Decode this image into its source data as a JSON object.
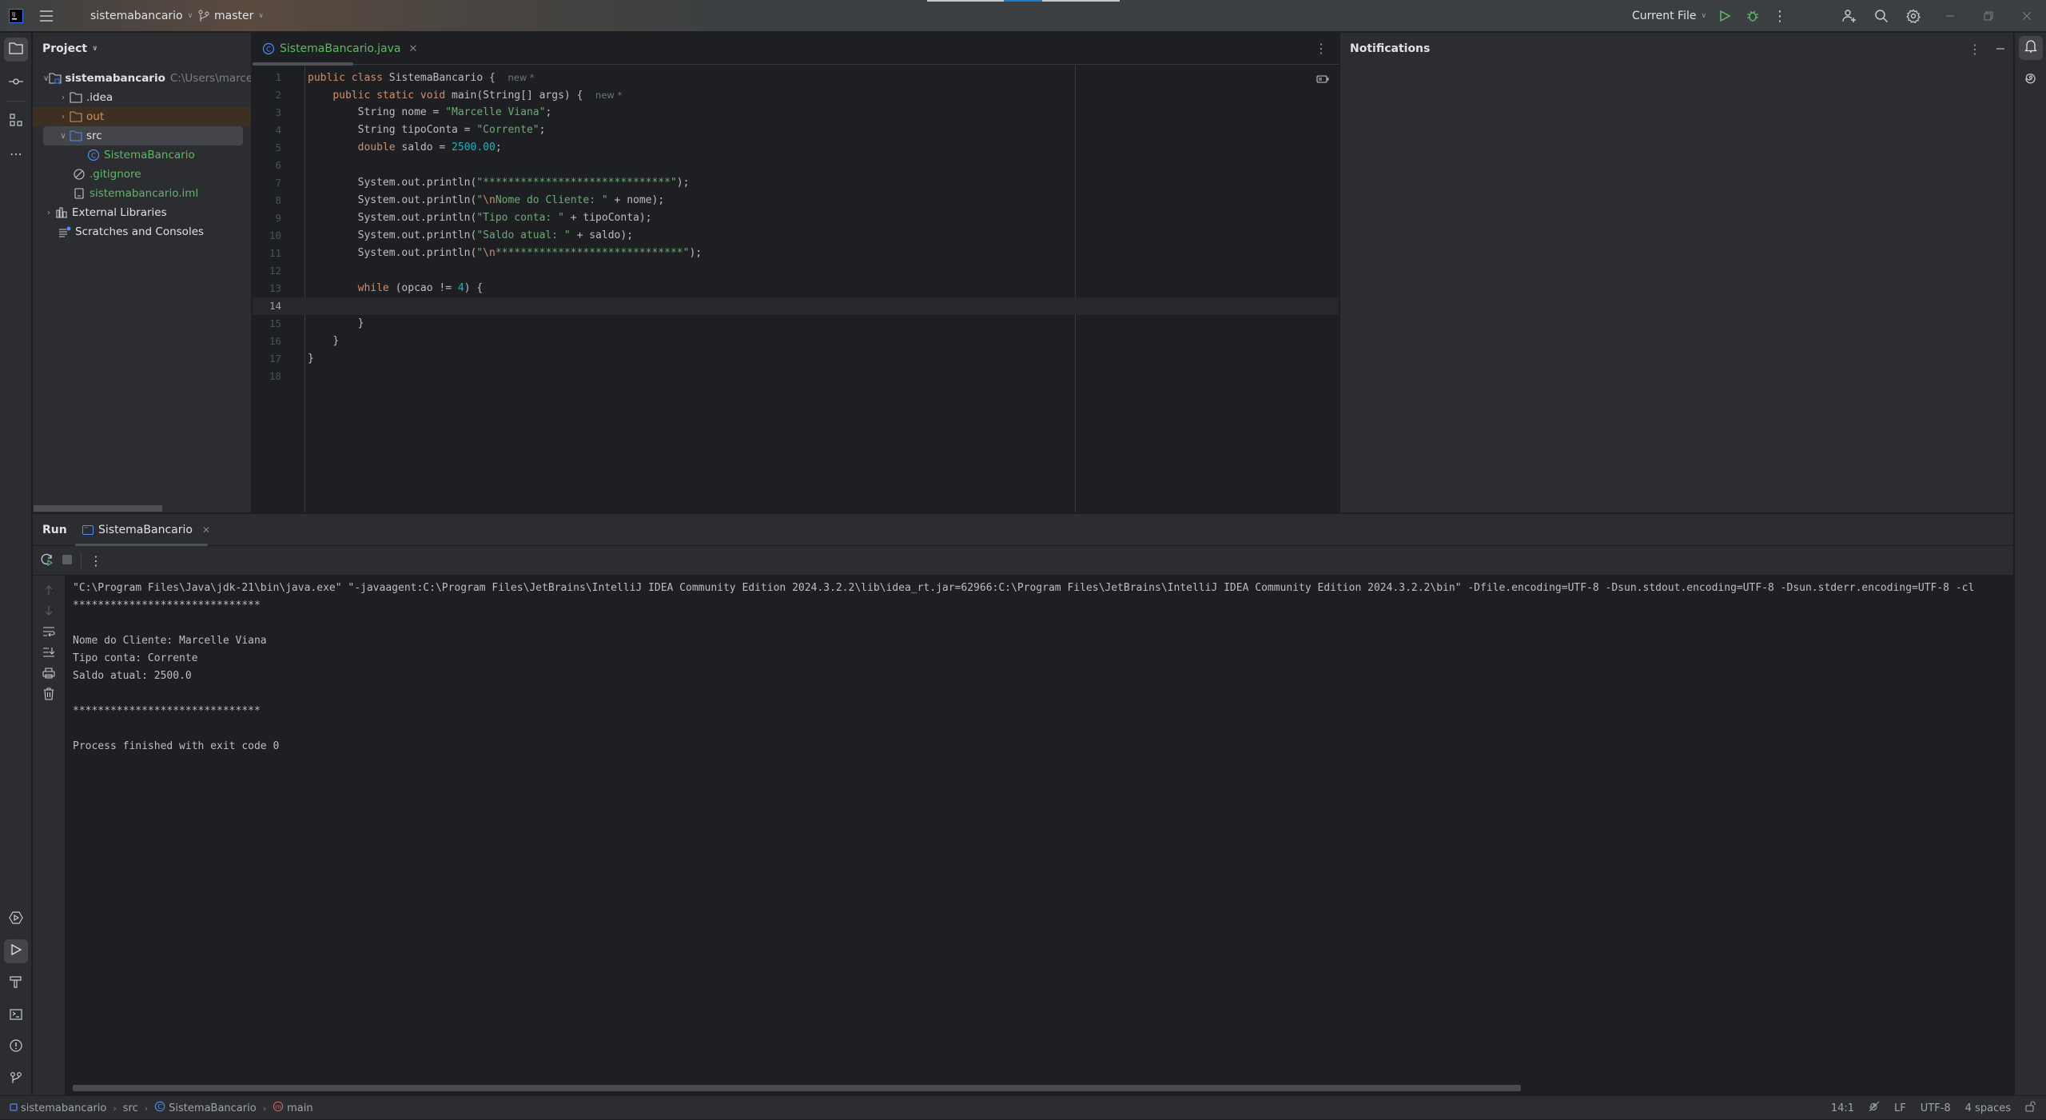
{
  "titlebar": {
    "project_name": "sistemabancario",
    "branch": "master",
    "run_config": "Current File",
    "window_controls": [
      "minimize",
      "restore",
      "close"
    ]
  },
  "left_strip": {
    "top_icons": [
      "folder-icon",
      "commit-icon",
      "structure-icon",
      "more-icon"
    ],
    "bottom_icons": [
      "services-icon",
      "run-icon",
      "build-icon",
      "terminal-icon",
      "problems-icon",
      "git-icon"
    ]
  },
  "project_panel": {
    "title": "Project",
    "tree": [
      {
        "label": "sistemabancario",
        "hint": "C:\\Users\\marce\\IdeaProjects\\sistemabancario",
        "icon": "module-folder-icon",
        "expanded": true,
        "depth": 0
      },
      {
        "label": ".idea",
        "icon": "folder-icon",
        "expanded": false,
        "depth": 1
      },
      {
        "label": "out",
        "icon": "folder-icon",
        "expanded": false,
        "depth": 1,
        "excluded": true
      },
      {
        "label": "src",
        "icon": "source-folder-icon",
        "expanded": true,
        "depth": 1,
        "selected": true
      },
      {
        "label": "SistemaBancario",
        "icon": "class-icon",
        "depth": 2
      },
      {
        "label": ".gitignore",
        "icon": "ignore-file-icon",
        "depth": 1
      },
      {
        "label": "sistemabancario.iml",
        "icon": "iml-file-icon",
        "depth": 1
      },
      {
        "label": "External Libraries",
        "icon": "library-icon",
        "expanded": false,
        "depth": 0
      },
      {
        "label": "Scratches and Consoles",
        "icon": "scratches-icon",
        "depth": 0
      }
    ]
  },
  "editor": {
    "tab_label": "SistemaBancario.java",
    "current_line": 14,
    "hint_new": "new *",
    "lines": [
      {
        "n": "1"
      },
      {
        "n": "2"
      },
      {
        "n": "3"
      },
      {
        "n": "4"
      },
      {
        "n": "5"
      },
      {
        "n": "6"
      },
      {
        "n": "7"
      },
      {
        "n": "8"
      },
      {
        "n": "9"
      },
      {
        "n": "10"
      },
      {
        "n": "11"
      },
      {
        "n": "12"
      },
      {
        "n": "13"
      },
      {
        "n": "14"
      },
      {
        "n": "15"
      },
      {
        "n": "16"
      },
      {
        "n": "17"
      },
      {
        "n": "18"
      }
    ],
    "code": {
      "l1_kw": "public class ",
      "l1_rest": "SistemaBancario {  ",
      "l2_kw": "public static void ",
      "l2_rest": "main(String[] args) {  ",
      "l3_pre": "String nome = ",
      "l3_str": "\"Marcelle Viana\"",
      "l4_pre": "String tipoConta = ",
      "l4_str": "\"Corrente\"",
      "l5_kw": "double ",
      "l5_pre": "saldo = ",
      "l5_num": "2500.00",
      "l7_str": "\"******************************\"",
      "l8_esc": "\\n",
      "l8_str": "Nome do Cliente: \"",
      "l8_post": " + nome);",
      "l9_str": "\"Tipo conta: \"",
      "l9_post": " + tipoConta);",
      "l10_str": "\"Saldo atual: \"",
      "l10_post": " + saldo);",
      "l11_esc": "\\n",
      "l11_str": "******************************\"",
      "println": "System.out.println(",
      "l13_kw": "while ",
      "l13_pre": "(opcao != ",
      "l13_num": "4",
      "l13_post": ") {",
      "semicolon": ";",
      "close_paren": ");",
      "open_quote": "\"",
      "brace": "}"
    }
  },
  "notifications": {
    "title": "Notifications"
  },
  "run_panel": {
    "label": "Run",
    "tab_label": "SistemaBancario",
    "command": "\"C:\\Program Files\\Java\\jdk-21\\bin\\java.exe\" \"-javaagent:C:\\Program Files\\JetBrains\\IntelliJ IDEA Community Edition 2024.3.2.2\\lib\\idea_rt.jar=62966:C:\\Program Files\\JetBrains\\IntelliJ IDEA Community Edition 2024.3.2.2\\bin\" -Dfile.encoding=UTF-8 -Dsun.stdout.encoding=UTF-8 -Dsun.stderr.encoding=UTF-8 -cl",
    "output": [
      "******************************",
      "",
      "Nome do Cliente: Marcelle Viana",
      "Tipo conta: Corrente",
      "Saldo atual: 2500.0",
      "",
      "******************************",
      "",
      "Process finished with exit code 0"
    ]
  },
  "statusbar": {
    "breadcrumbs": [
      "sistemabancario",
      "src",
      "SistemaBancario",
      "main"
    ],
    "position": "14:1",
    "line_separator": "LF",
    "encoding": "UTF-8",
    "indent": "4 spaces"
  },
  "colors": {
    "accent_blue": "#3574f0",
    "green": "#5fb865",
    "keyword": "#cf8e6d",
    "string": "#6aab73",
    "number": "#2aacb8"
  }
}
